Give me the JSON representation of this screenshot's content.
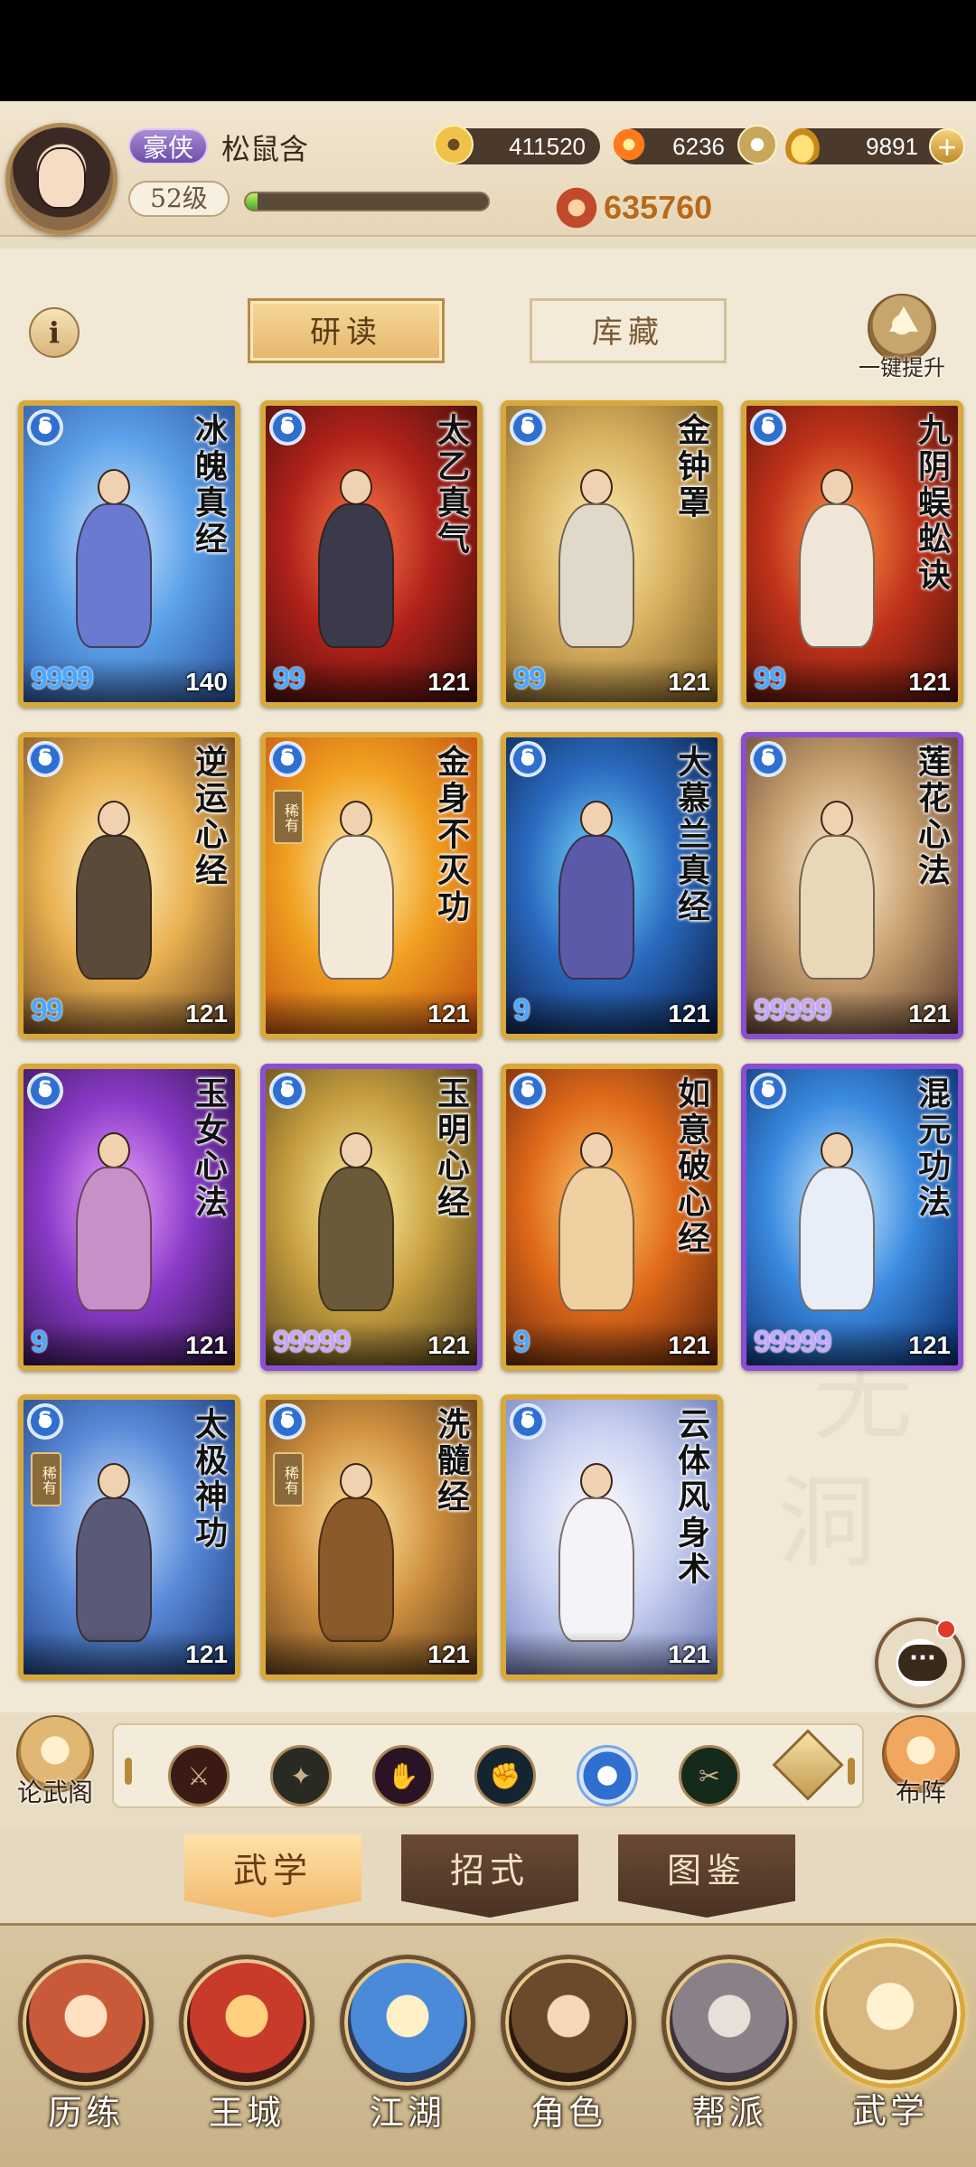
{
  "header": {
    "title_badge": "豪侠",
    "player_name": "松鼠含",
    "level": "52级",
    "xp_fraction": 0.05,
    "coins": "411520",
    "fire_currency": "6236",
    "gold_ingots": "9891",
    "combat_power": "635760"
  },
  "toolbar": {
    "info_label": "i",
    "tab_study": "研读",
    "tab_storage": "库藏",
    "upgrade_label": "一键提升"
  },
  "cards": [
    {
      "name": "冰魄真经",
      "stars": "9999",
      "level": "140",
      "frame": "gold",
      "rare": false,
      "rare_label": ""
    },
    {
      "name": "太乙真气",
      "stars": "99",
      "level": "121",
      "frame": "gold",
      "rare": false,
      "rare_label": ""
    },
    {
      "name": "金钟罩",
      "stars": "99",
      "level": "121",
      "frame": "gold",
      "rare": false,
      "rare_label": ""
    },
    {
      "name": "九阴蜈蚣诀",
      "stars": "99",
      "level": "121",
      "frame": "gold",
      "rare": false,
      "rare_label": ""
    },
    {
      "name": "逆运心经",
      "stars": "99",
      "level": "121",
      "frame": "gold",
      "rare": false,
      "rare_label": ""
    },
    {
      "name": "金身不灭功",
      "stars": "",
      "level": "121",
      "frame": "gold",
      "rare": true,
      "rare_label": "稀有"
    },
    {
      "name": "大慕兰真经",
      "stars": "9",
      "level": "121",
      "frame": "gold",
      "rare": false,
      "rare_label": ""
    },
    {
      "name": "莲花心法",
      "stars": "99999",
      "level": "121",
      "frame": "purple",
      "rare": false,
      "rare_label": ""
    },
    {
      "name": "玉女心法",
      "stars": "9",
      "level": "121",
      "frame": "gold",
      "rare": false,
      "rare_label": ""
    },
    {
      "name": "玉明心经",
      "stars": "99999",
      "level": "121",
      "frame": "purple",
      "rare": false,
      "rare_label": ""
    },
    {
      "name": "如意破心经",
      "stars": "9",
      "level": "121",
      "frame": "gold",
      "rare": false,
      "rare_label": ""
    },
    {
      "name": "混元功法",
      "stars": "99999",
      "level": "121",
      "frame": "purple",
      "rare": false,
      "rare_label": ""
    },
    {
      "name": "太极神功",
      "stars": "",
      "level": "121",
      "frame": "gold",
      "rare": true,
      "rare_label": "稀有"
    },
    {
      "name": "洗髓经",
      "stars": "",
      "level": "121",
      "frame": "gold",
      "rare": true,
      "rare_label": "稀有"
    },
    {
      "name": "云体风身术",
      "stars": "",
      "level": "121",
      "frame": "gold",
      "rare": false,
      "rare_label": ""
    }
  ],
  "filter": {
    "left_button": "论武阁",
    "right_button": "布阵",
    "categories": [
      "blade-icon",
      "sword-icon",
      "palm-icon",
      "fist-icon",
      "inner-art-icon",
      "movement-icon"
    ],
    "active_index": 4
  },
  "subtabs": [
    "武学",
    "招式",
    "图鉴"
  ],
  "subtab_active": 0,
  "nav": [
    "历练",
    "王城",
    "江湖",
    "角色",
    "帮派",
    "武学"
  ],
  "nav_active": 5,
  "colors": {
    "gold_frame": "#d8a93a",
    "purple_frame": "#8a4fd0",
    "star_blue": "#4aa8ff",
    "accent_orange": "#f0b76a"
  }
}
